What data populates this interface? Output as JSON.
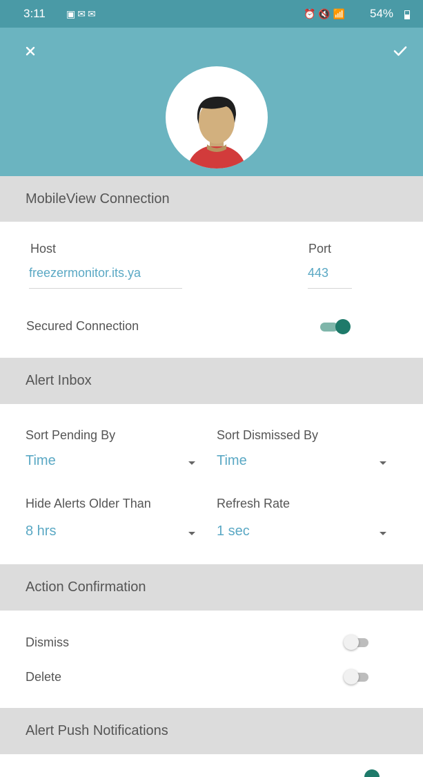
{
  "status_bar": {
    "time": "3:11",
    "battery": "54%"
  },
  "sections": {
    "mobileview": {
      "title": "MobileView Connection",
      "host_label": "Host",
      "host_value": "freezermonitor.its.ya",
      "port_label": "Port",
      "port_value": "443",
      "secured_label": "Secured Connection",
      "secured_on": true
    },
    "alert_inbox": {
      "title": "Alert Inbox",
      "sort_pending_label": "Sort Pending By",
      "sort_pending_value": "Time",
      "sort_dismissed_label": "Sort Dismissed By",
      "sort_dismissed_value": "Time",
      "hide_alerts_label": "Hide Alerts Older Than",
      "hide_alerts_value": "8 hrs",
      "refresh_label": "Refresh Rate",
      "refresh_value": "1 sec"
    },
    "action_confirmation": {
      "title": "Action Confirmation",
      "dismiss_label": "Dismiss",
      "dismiss_on": false,
      "delete_label": "Delete",
      "delete_on": false
    },
    "push": {
      "title": "Alert Push Notifications"
    }
  },
  "colors": {
    "header": "#6bb4c0",
    "status_bar": "#4a9aa6",
    "accent_text": "#5aa8c4",
    "toggle_on": "#1e7a6a",
    "section_bg": "#dcdcdc"
  },
  "icons": {
    "close": "close-icon",
    "confirm": "check-icon",
    "avatar": "user-avatar-icon"
  }
}
